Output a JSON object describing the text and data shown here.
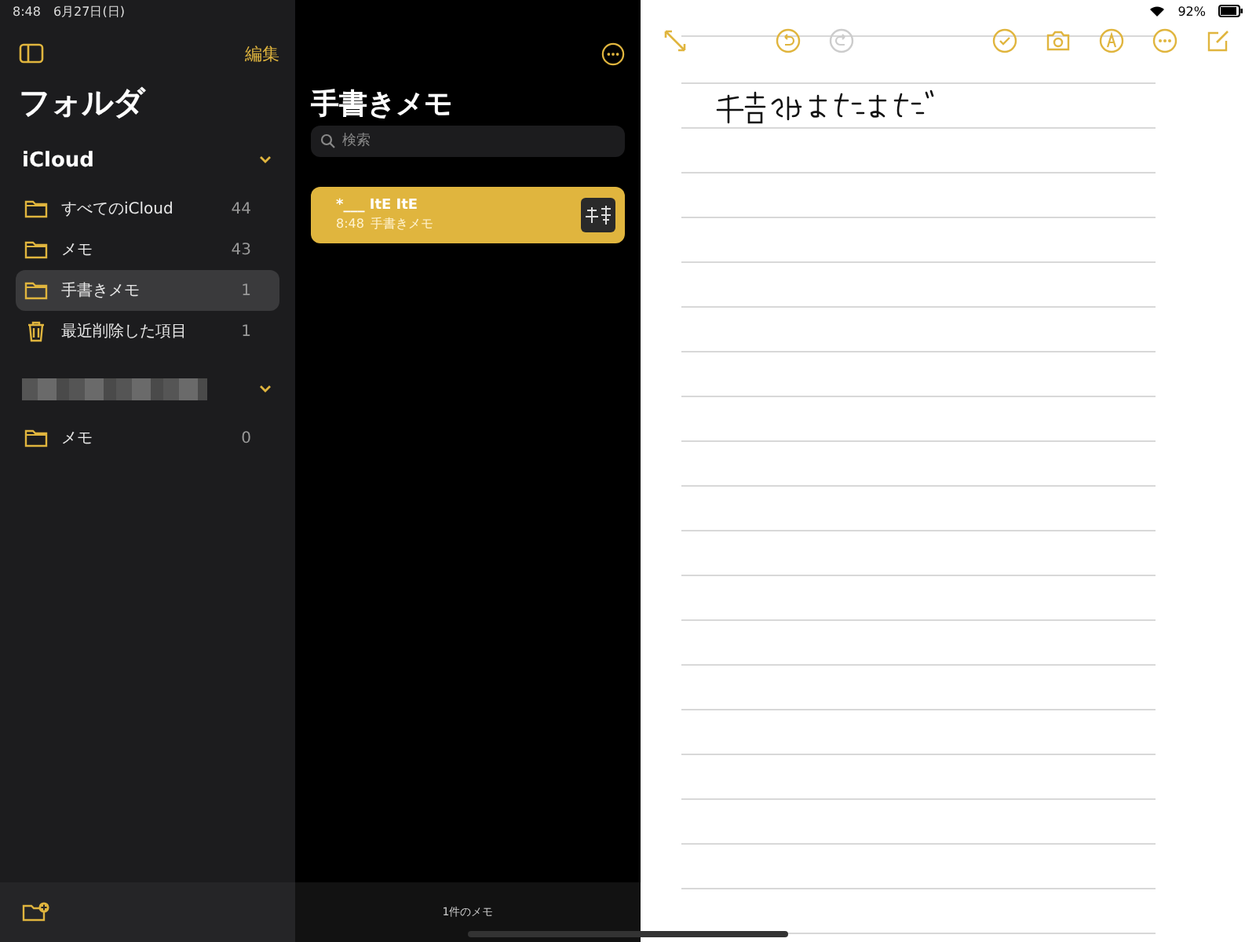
{
  "status_bar": {
    "time": "8:48",
    "date": "6月27日(日)",
    "battery": "92%"
  },
  "sidebar": {
    "edit": "編集",
    "title": "フォルダ",
    "sections": [
      {
        "title": "iCloud",
        "expanded": true,
        "items": [
          {
            "kind": "folder",
            "name": "すべてのiCloud",
            "count": "44",
            "selected": false
          },
          {
            "kind": "folder",
            "name": "メモ",
            "count": "43",
            "selected": false
          },
          {
            "kind": "folder",
            "name": "手書きメモ",
            "count": "1",
            "selected": true
          },
          {
            "kind": "trash",
            "name": "最近削除した項目",
            "count": "1",
            "selected": false
          }
        ]
      },
      {
        "expanded": true,
        "items": [
          {
            "kind": "folder",
            "name": "メモ",
            "count": "0",
            "selected": false
          }
        ]
      }
    ]
  },
  "note_list": {
    "title": "手書きメモ",
    "search": {
      "placeholder": "検索"
    },
    "notes": [
      {
        "title": "*___ ItE ItE",
        "time": "8:48",
        "folder": "手書きメモ",
        "selected": true
      }
    ],
    "footer": "1件のメモ"
  }
}
